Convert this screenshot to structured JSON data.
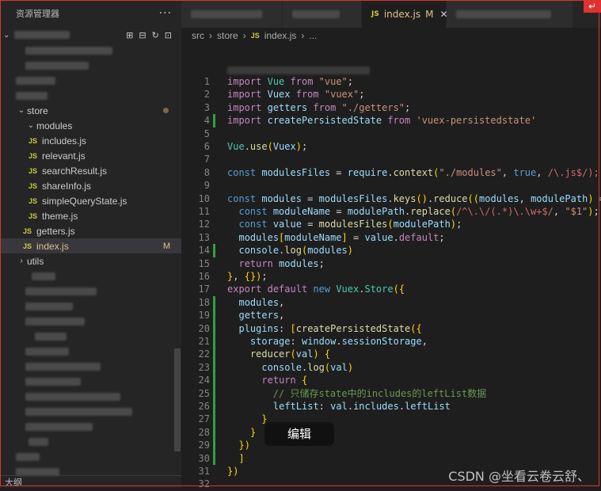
{
  "sidebar": {
    "title": "资源管理器",
    "more": "···",
    "store_label": "store",
    "modules_label": "modules",
    "module_files": [
      "includes.js",
      "relevant.js",
      "searchResult.js",
      "shareInfo.js",
      "simpleQueryState.js",
      "theme.js"
    ],
    "getters_file": "getters.js",
    "index_file": "index.js",
    "index_status": "M",
    "utils_label": "utils",
    "outline_label": "大纲",
    "icons": [
      "new-file-icon",
      "new-folder-icon",
      "refresh-icon",
      "collapse-icon"
    ]
  },
  "tabs": {
    "active_label": "index.js",
    "active_status": "M",
    "close": "✕"
  },
  "breadcrumb": {
    "p1": "src",
    "p2": "store",
    "p3": "index.js",
    "p4": "..."
  },
  "editor": {
    "lines": [
      {
        "n": "1",
        "code": "import Vue from \"vue\";"
      },
      {
        "n": "2",
        "code": "import Vuex from \"vuex\";"
      },
      {
        "n": "3",
        "code": "import getters from \"./getters\";"
      },
      {
        "n": "4",
        "code": "import createPersistedState from 'vuex-persistedstate'"
      },
      {
        "n": "5",
        "code": ""
      },
      {
        "n": "6",
        "code": "Vue.use(Vuex);"
      },
      {
        "n": "7",
        "code": ""
      },
      {
        "n": "8",
        "code": "const modulesFiles = require.context(\"./modules\", true, /\\.js$/);"
      },
      {
        "n": "9",
        "code": ""
      },
      {
        "n": "10",
        "code": "const modules = modulesFiles.keys().reduce((modules, modulePath) => {"
      },
      {
        "n": "11",
        "code": "  const moduleName = modulePath.replace(/^\\.\\/(.*)\\.\\w+$/, \"$1\");"
      },
      {
        "n": "12",
        "code": "  const value = modulesFiles(modulePath);"
      },
      {
        "n": "13",
        "code": "  modules[moduleName] = value.default;"
      },
      {
        "n": "14",
        "code": "  console.log(modules)"
      },
      {
        "n": "15",
        "code": "  return modules;"
      },
      {
        "n": "16",
        "code": "}, {});"
      },
      {
        "n": "17",
        "code": "export default new Vuex.Store({"
      },
      {
        "n": "18",
        "code": "  modules,"
      },
      {
        "n": "19",
        "code": "  getters,"
      },
      {
        "n": "20",
        "code": "  plugins: [createPersistedState({"
      },
      {
        "n": "21",
        "code": "    storage: window.sessionStorage,"
      },
      {
        "n": "22",
        "code": "    reducer(val) {"
      },
      {
        "n": "23",
        "code": "      console.log(val)"
      },
      {
        "n": "24",
        "code": "      return {"
      },
      {
        "n": "25",
        "code": "        // 只储存state中的includes的leftList数据"
      },
      {
        "n": "26",
        "code": "        leftList: val.includes.leftList"
      },
      {
        "n": "27",
        "code": "      }"
      },
      {
        "n": "28",
        "code": "    }"
      },
      {
        "n": "29",
        "code": "  })"
      },
      {
        "n": "30",
        "code": "  ]"
      },
      {
        "n": "31",
        "code": "})"
      },
      {
        "n": "32",
        "code": ""
      }
    ]
  },
  "tooltip": "编辑",
  "watermark": "CSDN @坐看云卷云舒、",
  "colors": {
    "accent_red": "#e0322f",
    "modified": "#e2c08d",
    "js_icon": "#cbcb41",
    "git_added": "#2ea043"
  }
}
